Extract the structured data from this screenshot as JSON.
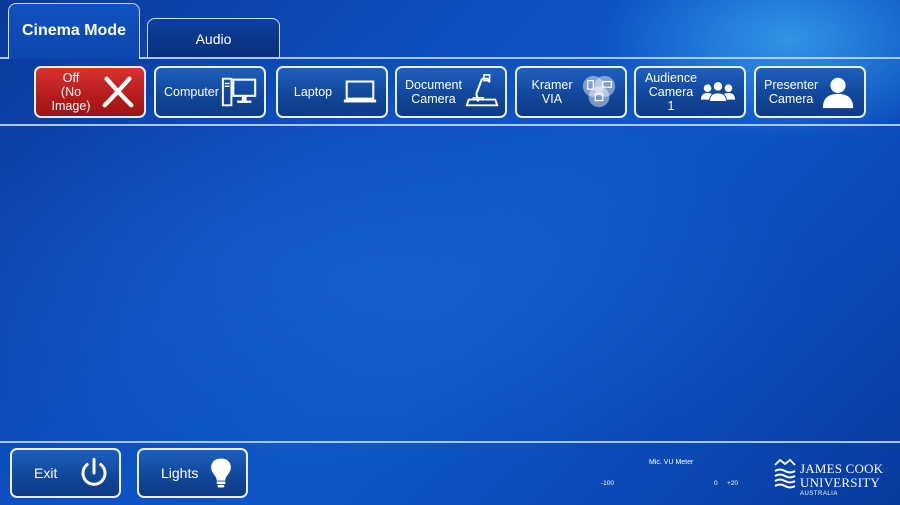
{
  "tabs": {
    "cinema": "Cinema Mode",
    "audio": "Audio"
  },
  "sources": [
    {
      "label": "Off\n(No Image)",
      "icon": "x-icon",
      "color": "#c42222"
    },
    {
      "label": "Computer",
      "icon": "computer-icon"
    },
    {
      "label": "Laptop",
      "icon": "laptop-icon"
    },
    {
      "label": "Document\nCamera",
      "icon": "document-camera-icon"
    },
    {
      "label": "Kramer\nVIA",
      "icon": "kramer-via-icon"
    },
    {
      "label": "Audience\nCamera 1",
      "icon": "audience-icon"
    },
    {
      "label": "Presenter\nCamera",
      "icon": "presenter-icon"
    }
  ],
  "bottom": {
    "exit_label": "Exit",
    "lights_label": "Lights"
  },
  "vu_meter": {
    "title": "Mic. VU Meter",
    "tick_min": "-100",
    "tick_zero": "0",
    "tick_max": "+20"
  },
  "logo": {
    "line1": "JAMES COOK",
    "line2": "UNIVERSITY",
    "line3": "AUSTRALIA"
  },
  "colors": {
    "background": "#0e56c8",
    "button": "#12479b",
    "off_button": "#c42222",
    "border": "#e8f0ff"
  }
}
